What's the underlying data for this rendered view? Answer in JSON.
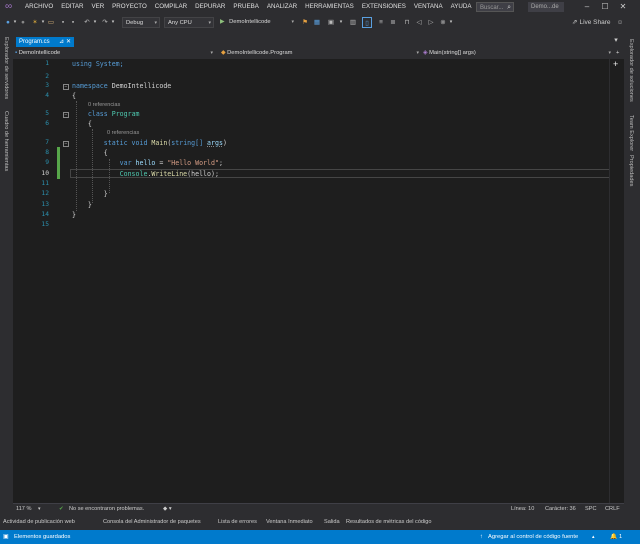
{
  "menu": {
    "items": [
      "ARCHIVO",
      "EDITAR",
      "VER",
      "PROYECTO",
      "COMPILAR",
      "DEPURAR",
      "PRUEBA",
      "ANALIZAR",
      "HERRAMIENTAS",
      "EXTENSIONES",
      "VENTANA",
      "AYUDA"
    ],
    "search_placeholder": "Buscar...",
    "project_name": "Demo...de"
  },
  "toolbar": {
    "config": "Debug",
    "platform": "Any CPU",
    "start_target": "DemoIntellicode",
    "live_share": "Live Share"
  },
  "left_strip": {
    "panels": [
      "Explorador de servidores",
      "Cuadro de herramientas"
    ]
  },
  "right_strip": {
    "panels": [
      "Explorador de soluciones",
      "Team Explorer",
      "Propiedades"
    ]
  },
  "document_tab": {
    "title": "Program.cs",
    "pin": "⊿",
    "close": "✕"
  },
  "navbar": {
    "project": "DemoIntellicode",
    "class": "DemoIntellicode.Program",
    "member": "Main(string[] args)"
  },
  "editor": {
    "line_numbers": [
      "1",
      "2",
      "3",
      "4",
      "5",
      "6",
      "7",
      "8",
      "9",
      "10",
      "11",
      "12",
      "13",
      "14",
      "15"
    ],
    "codelens_class": "0 referencias",
    "codelens_method": "0 referencias",
    "line1": "using System;",
    "ns_kw": "namespace",
    "ns_name": "DemoIntellicode",
    "brace_open": "{",
    "brace_close": "}",
    "class_kw": "class",
    "class_name": "Program",
    "static_kw": "static void",
    "main_name": "Main",
    "main_params_open": "(",
    "string_kw": "string[]",
    "args_name": "args",
    "main_params_close": ")",
    "var_kw": "var",
    "hello_var": "hello",
    "assign": " = ",
    "hello_str": "\"Hello World\"",
    "semicolon": ";",
    "console_cls": "Console",
    "dot": ".",
    "writeline": "WriteLine",
    "call_args": "(hello);"
  },
  "editor_status": {
    "zoom": "117 %",
    "issues": "No se encontraron problemas.",
    "line": "Línea: 10",
    "char": "Carácter: 36",
    "spc": "SPC",
    "crlf": "CRLF"
  },
  "bottom_tabs": [
    "Actividad de publicación web",
    "Consola del Administrador de paquetes",
    "Lista de errores",
    "Ventana Inmediato",
    "Salida",
    "Resultados de métricas del código"
  ],
  "status_bar": {
    "left": "Elementos guardados",
    "source_control": "Agregar al control de código fuente",
    "notifications": "1"
  },
  "colors": {
    "accent": "#007acc",
    "editor_bg": "#1e1e1e",
    "chrome_bg": "#2d2d30"
  }
}
